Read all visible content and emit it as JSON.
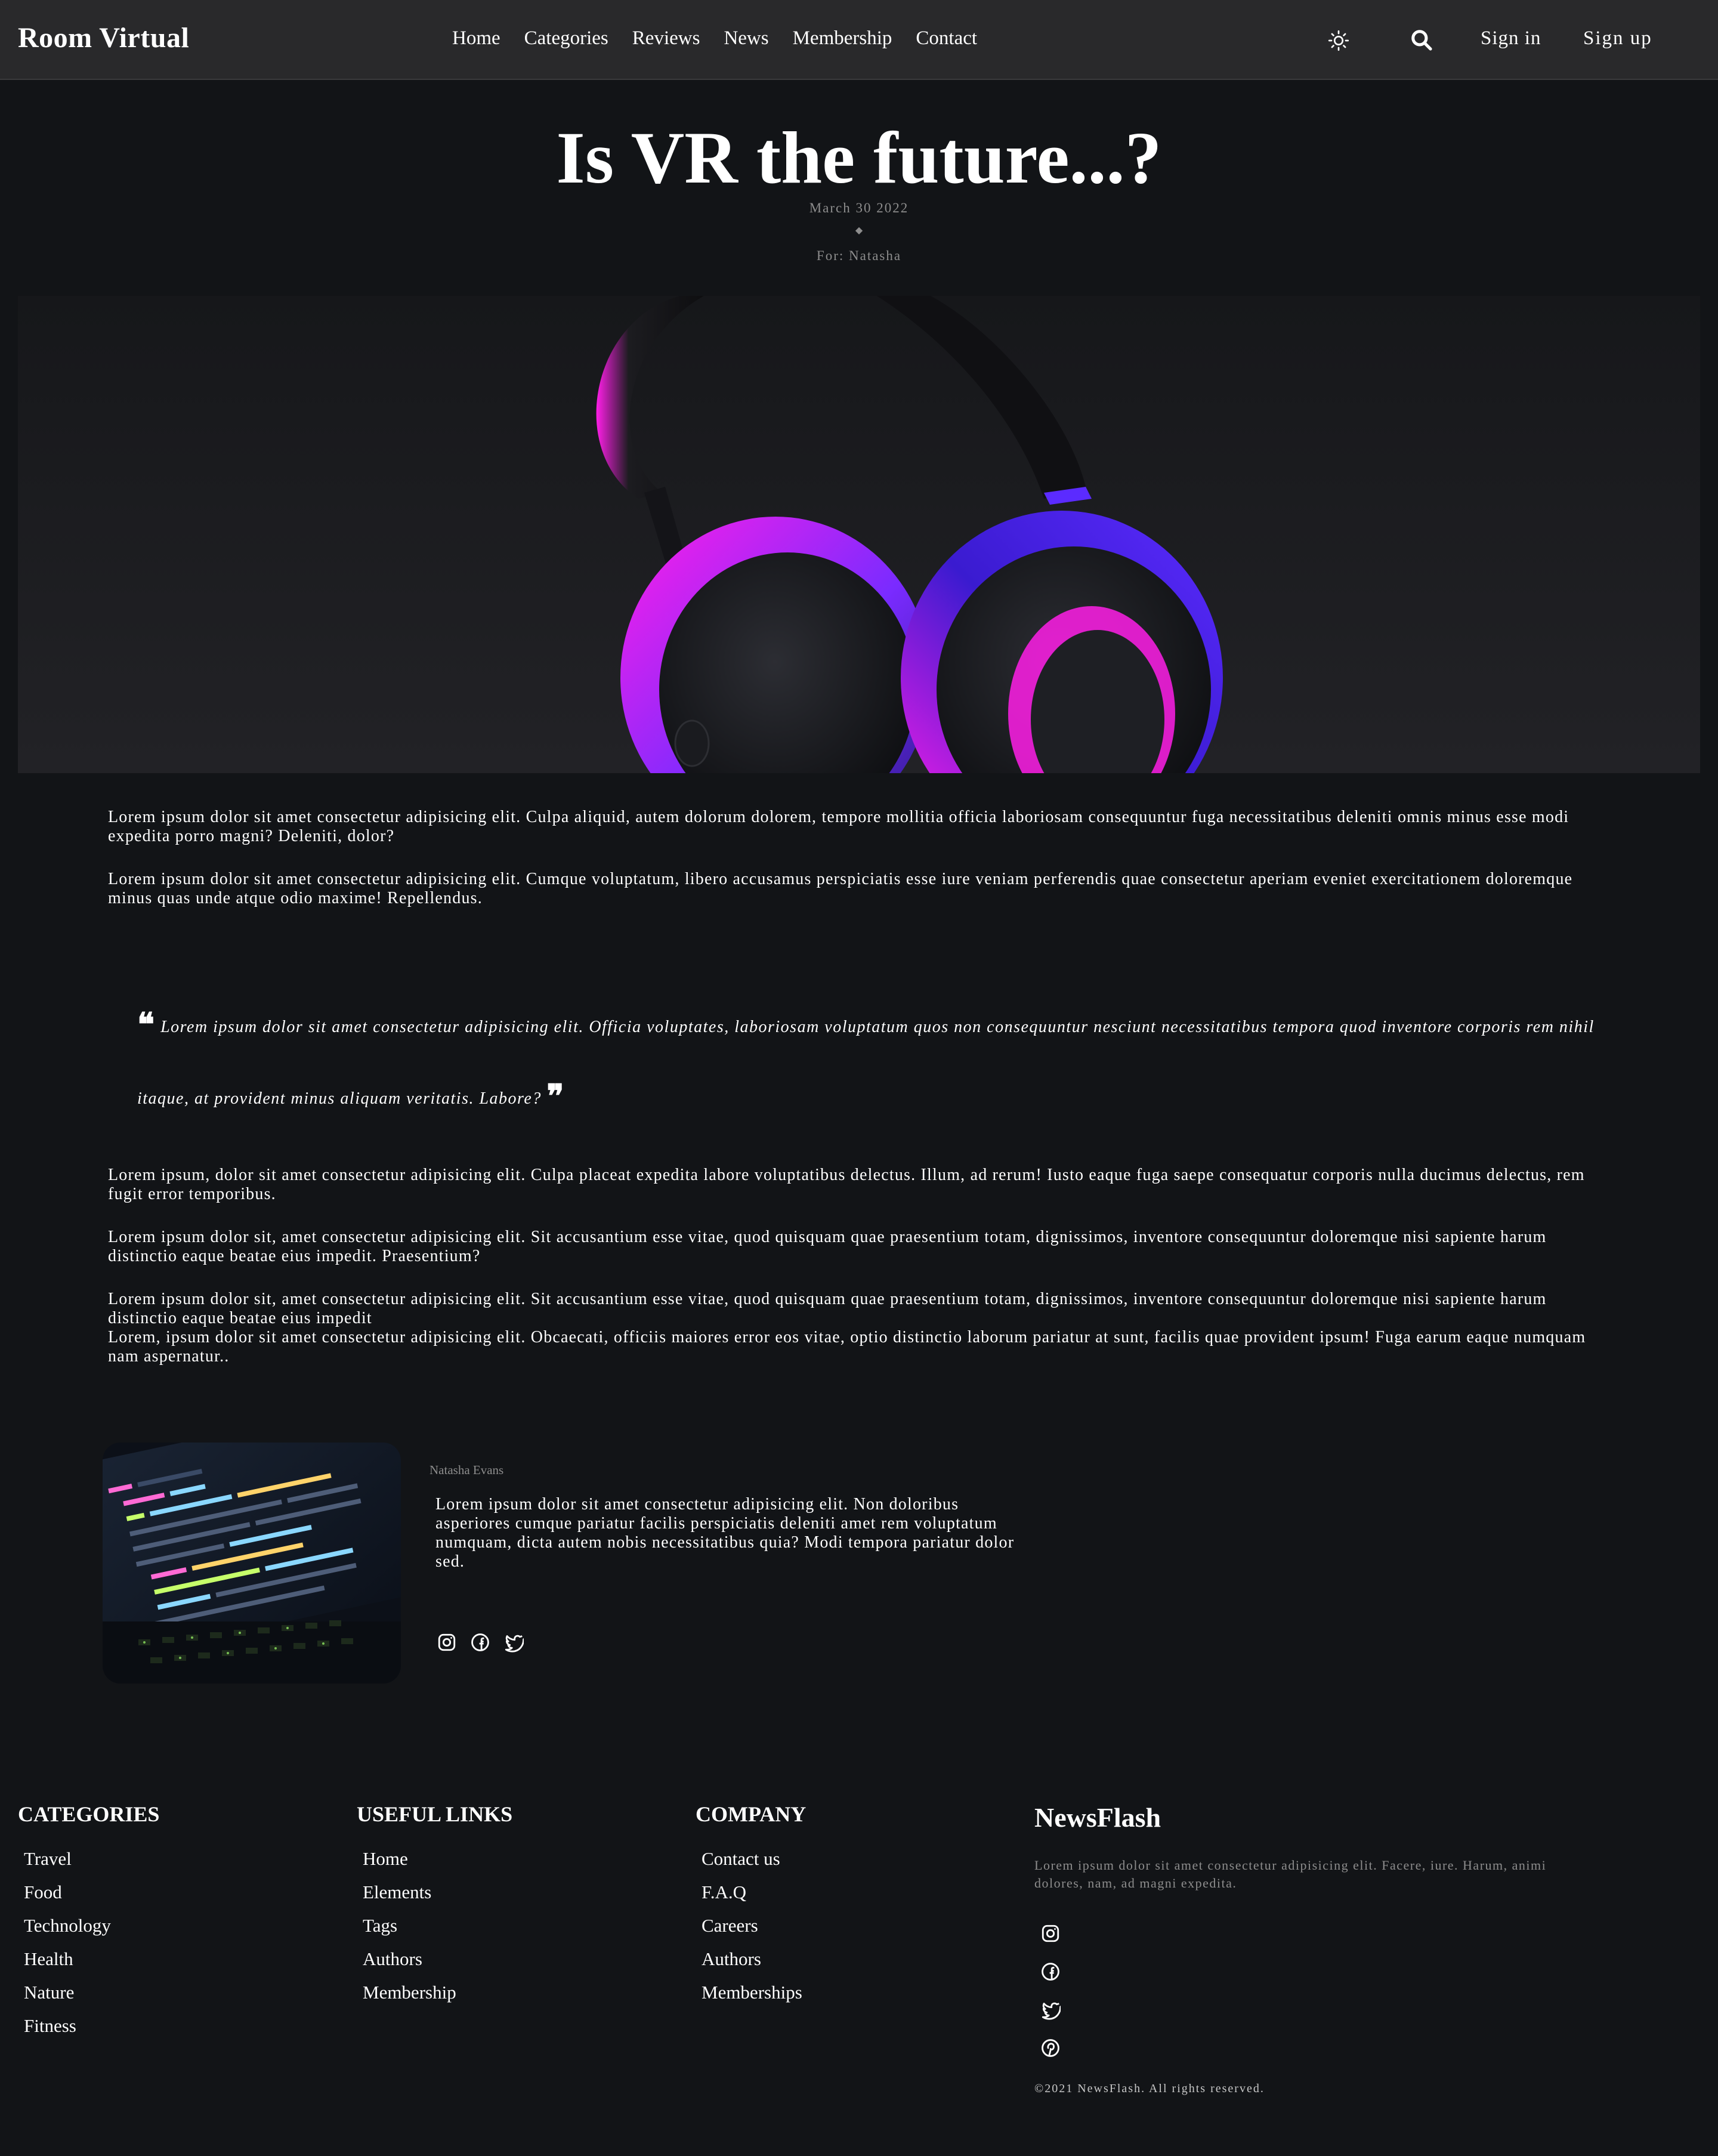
{
  "nav": {
    "brand": "Room Virtual",
    "links": [
      "Home",
      "Categories",
      "Reviews",
      "News",
      "Membership",
      "Contact"
    ],
    "theme_icon": "sun-icon",
    "search_icon": "search-icon",
    "signin": "Sign in",
    "signup": "Sign up"
  },
  "post": {
    "title": "Is VR the future...?",
    "date": "March 30 2022",
    "separator": "◆",
    "author": "For: Natasha",
    "hero_image": "vr-headphones-image"
  },
  "article": {
    "paragraphs": [
      "Lorem ipsum dolor sit amet consectetur adipisicing elit. Culpa aliquid, autem dolorum dolorem, tempore mollitia officia laboriosam consequuntur fuga necessitatibus deleniti omnis minus esse modi expedita porro magni? Deleniti, dolor?",
      "Lorem ipsum dolor sit amet consectetur adipisicing elit. Cumque voluptatum, libero accusamus perspiciatis esse iure veniam perferendis quae consectetur aperiam eveniet exercitationem doloremque minus quas unde atque odio maxime! Repellendus.",
      "Lorem ipsum, dolor sit amet consectetur adipisicing elit. Culpa placeat expedita labore voluptatibus delectus. Illum, ad rerum! Iusto eaque fuga saepe consequatur corporis nulla ducimus delectus, rem fugit error temporibus.",
      "Lorem ipsum dolor sit, amet consectetur adipisicing elit. Sit accusantium esse vitae, quod quisquam quae praesentium totam, dignissimos, inventore consequuntur doloremque nisi sapiente harum distinctio eaque beatae eius impedit. Praesentium?",
      "Lorem ipsum dolor sit, amet consectetur adipisicing elit. Sit accusantium esse vitae, quod quisquam quae praesentium totam, dignissimos, inventore consequuntur doloremque nisi sapiente harum distinctio eaque beatae eius impedit",
      "Lorem, ipsum dolor sit amet consectetur adipisicing elit. Obcaecati, officiis maiores error eos vitae, optio distinctio laborum pariatur at sunt, facilis quae provident ipsum! Fuga earum eaque numquam nam aspernatur.."
    ],
    "quote": "Lorem ipsum dolor sit amet consectetur adipisicing elit. Officia voluptates, laboriosam voluptatum quos non consequuntur nesciunt necessitatibus tempora quod inventore corporis rem nihil itaque, at provident minus aliquam veritatis. Labore?",
    "quote_open": "❝",
    "quote_close": "❞"
  },
  "author_card": {
    "image": "code-laptop-image",
    "name": "Natasha Evans",
    "bio": "Lorem ipsum dolor sit amet consectetur adipisicing elit. Non doloribus asperiores cumque pariatur facilis perspiciatis deleniti amet rem voluptatum numquam, dicta autem nobis necessitatibus quia? Modi tempora pariatur dolor sed.",
    "social": [
      "instagram-icon",
      "facebook-icon",
      "twitter-icon"
    ]
  },
  "footer": {
    "categories": {
      "title": "CATEGORIES",
      "items": [
        "Travel",
        "Food",
        "Technology",
        "Health",
        "Nature",
        "Fitness"
      ]
    },
    "useful_links": {
      "title": "USEFUL LINKS",
      "items": [
        "Home",
        "Elements",
        "Tags",
        "Authors",
        "Membership"
      ]
    },
    "company": {
      "title": "COMPANY",
      "items": [
        "Contact us",
        "F.A.Q",
        "Careers",
        "Authors",
        "Memberships"
      ]
    },
    "newsflash": {
      "title": "NewsFlash",
      "text": "Lorem ipsum dolor sit amet consectetur adipisicing elit. Facere, iure. Harum, animi dolores, nam, ad magni expedita.",
      "social": [
        "instagram-icon",
        "facebook-icon",
        "twitter-icon",
        "pinterest-icon"
      ]
    },
    "copyright": "©2021 NewsFlash. All rights reserved."
  },
  "colors": {
    "background": "#121417",
    "nav_background": "#29292b",
    "muted_text": "#8d8d8d",
    "accent_magenta": "#ff1ee8",
    "accent_violet": "#5b2bff"
  }
}
